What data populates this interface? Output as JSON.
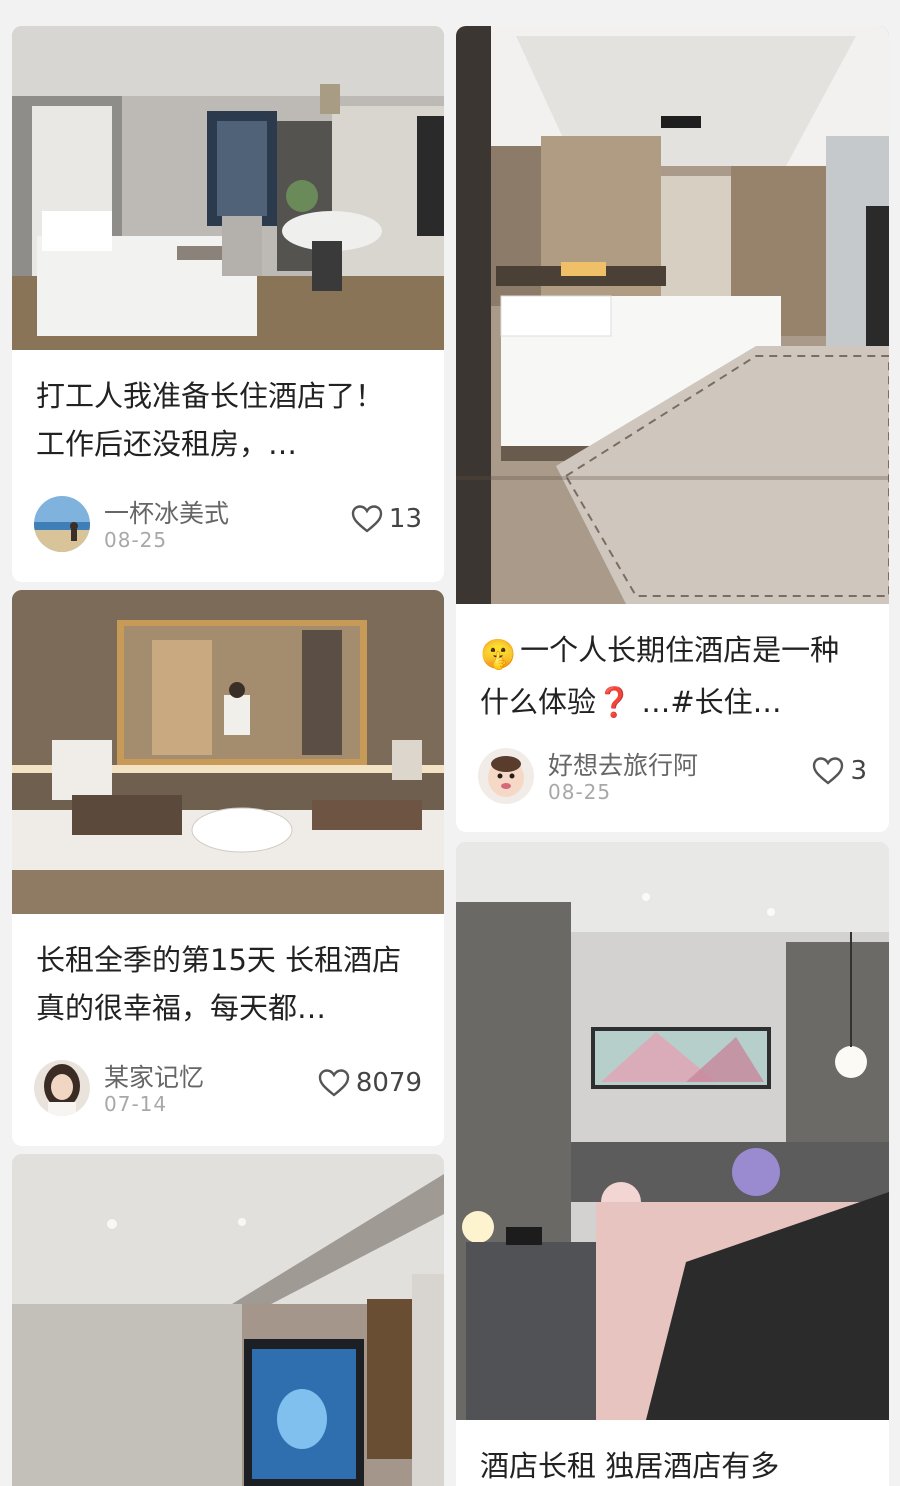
{
  "posts": [
    {
      "title": "打工人我准备长住酒店了！ 工作后还没租房，…",
      "author": "一杯冰美式",
      "date": "08-25",
      "likes": "13",
      "avatar_icon": "beach-person-avatar"
    },
    {
      "emoji": "🤫",
      "title": "一个人长期住酒店是一种什么体验❓ …#长住…",
      "author": "好想去旅行阿",
      "date": "08-25",
      "likes": "3",
      "avatar_icon": "baby-avatar"
    },
    {
      "title": "长租全季的第15天 长租酒店真的很幸福，每天都…",
      "author": "某家记忆",
      "date": "07-14",
      "likes": "8079",
      "avatar_icon": "woman-avatar"
    },
    {
      "title": "酒店长租 独居酒店有多"
    }
  ],
  "icons": {
    "like": "heart-outline-icon"
  },
  "colors": {
    "background": "#f2f2f2",
    "card": "#ffffff",
    "title": "#222222",
    "author": "#666666",
    "date": "#a8a8a8"
  }
}
